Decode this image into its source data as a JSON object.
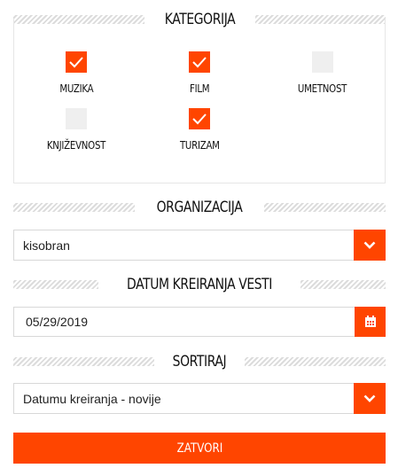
{
  "category": {
    "title": "KATEGORIJA",
    "items": [
      {
        "label": "MUZIKA",
        "checked": true
      },
      {
        "label": "FILM",
        "checked": true
      },
      {
        "label": "UMETNOST",
        "checked": false
      },
      {
        "label": "KNJIŽEVNOST",
        "checked": false
      },
      {
        "label": "TURIZAM",
        "checked": true
      }
    ]
  },
  "organization": {
    "title": "ORGANIZACIJA",
    "value": "kisobran",
    "icon": "chevron-down-icon"
  },
  "date": {
    "title": "DATUM KREIRANJA VESTI",
    "value": "05/29/2019",
    "icon": "calendar-icon"
  },
  "sort": {
    "title": "SORTIRAJ",
    "value": "Datumu kreiranja - novije",
    "icon": "chevron-down-icon"
  },
  "close_button": {
    "label": "ZATVORI"
  },
  "colors": {
    "accent": "#ff4500",
    "unchecked": "#efefef",
    "stripe": "#dcdcdc"
  }
}
